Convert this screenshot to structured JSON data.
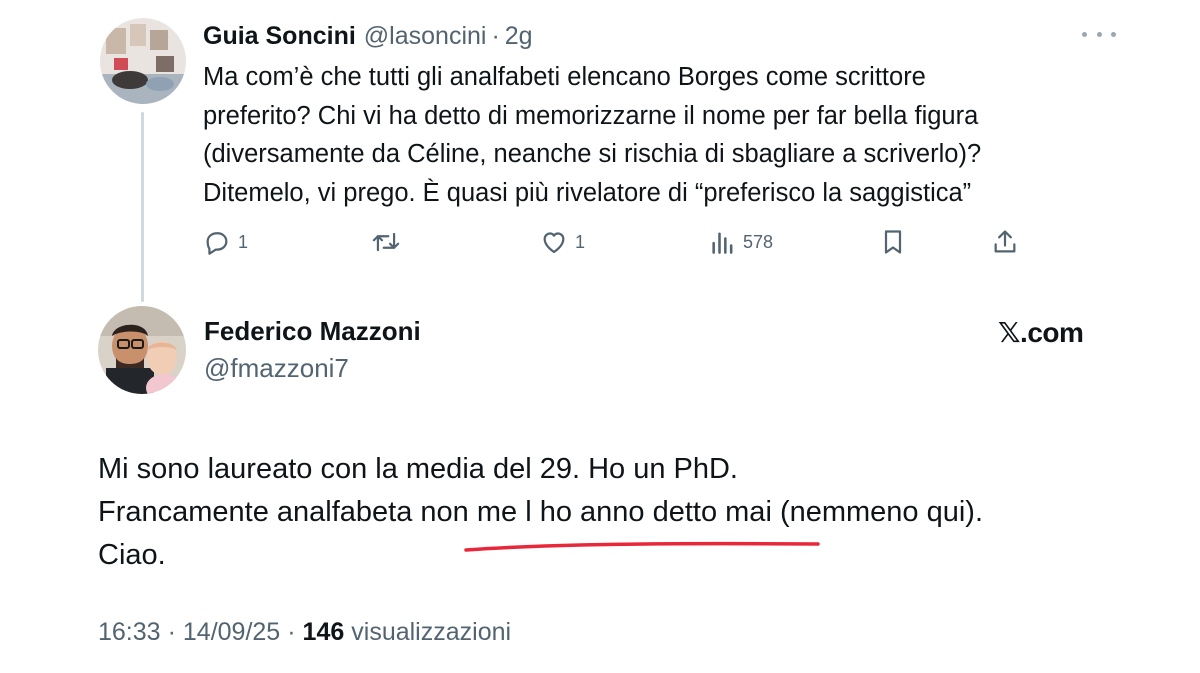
{
  "quoted_post": {
    "author_name": "Guia Soncini",
    "handle": "@lasoncini",
    "separator": "·",
    "time": "2g",
    "text_lines": [
      "Ma com’è che tutti gli analfabeti elencano Borges come scrittore",
      "preferito? Chi vi ha detto di memorizzarne il nome per far bella figura",
      "(diversamente da Céline, neanche si rischia di sbagliare a scriverlo)?",
      "Ditemelo, vi prego. È quasi più rivelatore di “preferisco la saggistica”"
    ],
    "actions": {
      "reply_count": "1",
      "repost_count": "",
      "like_count": "1",
      "views_count": "578"
    },
    "icons": [
      "reply-icon",
      "repost-icon",
      "like-icon",
      "views-icon",
      "bookmark-icon",
      "share-icon",
      "more-icon"
    ]
  },
  "main_post": {
    "author_name": "Federico Mazzoni",
    "handle": "@fmazzoni7",
    "text_lines": [
      "Mi sono laureato con la media del 29. Ho un PhD.",
      "Francamente analfabeta non me l ho anno detto mai (nemmeno qui).",
      "Ciao."
    ],
    "annotation_color": "#e8283a"
  },
  "watermark": "𝕏.com",
  "footer": {
    "time": "16:33",
    "separator": "·",
    "date": "14/09/25",
    "views_count": "146",
    "views_label": "visualizzazioni"
  },
  "colors": {
    "text_primary": "#0f1419",
    "text_secondary": "#536471",
    "thread_line": "#cfd9de"
  }
}
